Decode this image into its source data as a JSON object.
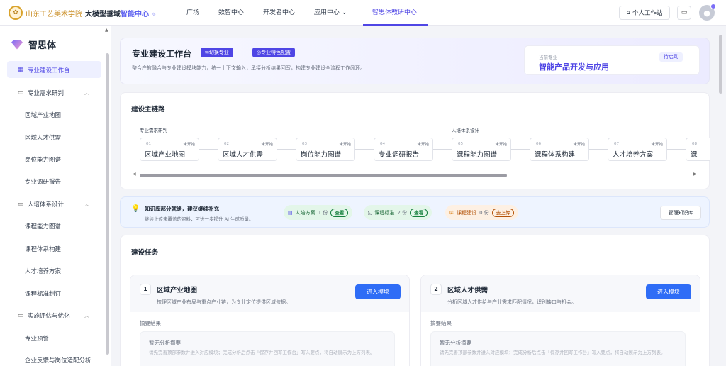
{
  "header": {
    "school_name": "山东工艺美术学院",
    "brand_prefix": "大模型垂域",
    "brand_accent": "智能中心",
    "nav": [
      {
        "label": "广场"
      },
      {
        "label": "数智中心"
      },
      {
        "label": "开发者中心"
      },
      {
        "label": "应用中心"
      },
      {
        "label": "智思体教研中心"
      }
    ],
    "workspace_label": "个人工作站",
    "accent_color": "#4f46e5"
  },
  "sidebar": {
    "title": "智思体",
    "items": [
      {
        "label": "专业建设工作台"
      },
      {
        "label": "专业需求研判"
      },
      {
        "label": "区域产业地图"
      },
      {
        "label": "区域人才供需"
      },
      {
        "label": "岗位能力图谱"
      },
      {
        "label": "专业调研报告"
      },
      {
        "label": "人培体系设计"
      },
      {
        "label": "课程能力图谱"
      },
      {
        "label": "课程体系构建"
      },
      {
        "label": "人才培养方案"
      },
      {
        "label": "课程标准制订"
      },
      {
        "label": "实施评估与优化"
      },
      {
        "label": "专业预警"
      },
      {
        "label": "企业反馈与岗位适配分析"
      }
    ]
  },
  "hero": {
    "title": "专业建设工作台",
    "switch_label": "⇆切换专业",
    "config_label": "◎专业特色配置",
    "desc": "整合产教融合与专业建设模块能力，统一上下文输入，承接分析结果回写，构建专业建设全流程工作闭环。",
    "current_label": "当前专业",
    "current_name": "智能产品开发与应用",
    "current_status": "待启动"
  },
  "chain": {
    "title": "建设主链路",
    "group1": "专业需求研判",
    "group2": "人培体系设计",
    "steps": [
      {
        "num": "01",
        "status": "未开始",
        "name": "区域产业地图"
      },
      {
        "num": "02",
        "status": "未开始",
        "name": "区域人才供需"
      },
      {
        "num": "03",
        "status": "未开始",
        "name": "岗位能力图谱"
      },
      {
        "num": "04",
        "status": "未开始",
        "name": "专业调研报告"
      },
      {
        "num": "05",
        "status": "未开始",
        "name": "课程能力图谱"
      },
      {
        "num": "06",
        "status": "未开始",
        "name": "课程体系构建"
      },
      {
        "num": "07",
        "status": "未开始",
        "name": "人才培养方案"
      },
      {
        "num": "08",
        "status": "",
        "name": "课"
      }
    ]
  },
  "kb": {
    "title": "知识库部分就绪，建议继续补充",
    "sub": "继续上传未覆盖的资料，可进一步提升 AI 生成质量。",
    "chips": [
      {
        "label": "人培方案",
        "count": "1 份",
        "action": "查看",
        "color": "#16a34a"
      },
      {
        "label": "课程标准",
        "count": "2 份",
        "action": "查看",
        "color": "#16a34a"
      },
      {
        "label": "课程建设",
        "count": "0 份",
        "action": "去上传",
        "color": "#d97706"
      }
    ],
    "manage_label": "管理知识库"
  },
  "tasks": {
    "title": "建设任务",
    "items": [
      {
        "num": "1",
        "name": "区域产业地图",
        "desc": "梳理区域产业布局与重点产业链，为专业定位提供区域依据。",
        "enter": "进入模块",
        "summary_label": "摘要结果",
        "empty_title": "暂无分析摘要",
        "empty_desc": "请先完善顶部参数并进入对应模块；完成分析后点击「保存并回写工作台」写入要点，将自动展示为上方列表。"
      },
      {
        "num": "2",
        "name": "区域人才供需",
        "desc": "分析区域人才供给与产业需求匹配情况，识别缺口与机会。",
        "enter": "进入模块",
        "summary_label": "摘要结果",
        "empty_title": "暂无分析摘要",
        "empty_desc": "请先完善顶部参数并进入对应模块；完成分析后点击「保存并回写工作台」写入要点，将自动展示为上方列表。"
      }
    ]
  }
}
